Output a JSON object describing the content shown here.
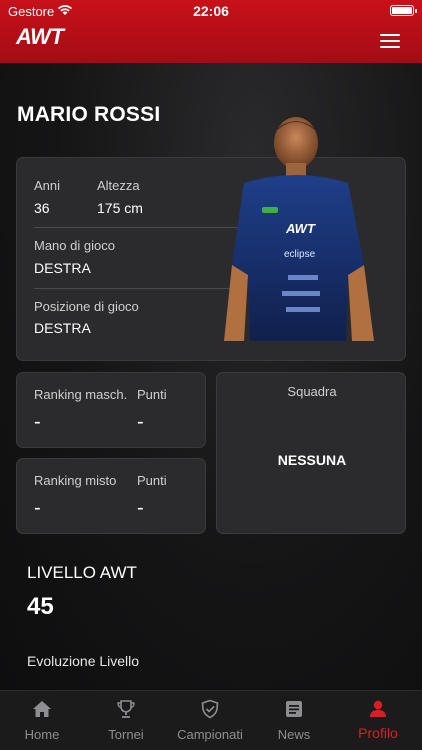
{
  "status_bar": {
    "carrier": "Gestore",
    "time": "22:06"
  },
  "header": {
    "logo": "AWT",
    "menu_icon": "hamburger-menu-icon"
  },
  "player": {
    "name": "MARIO ROSSI",
    "age_label": "Anni",
    "age_value": "36",
    "height_label": "Altezza",
    "height_value": "175 cm",
    "hand_label": "Mano di gioco",
    "hand_value": "DESTRA",
    "position_label": "Posizione di gioco",
    "position_value": "DESTRA"
  },
  "ranking_male": {
    "label": "Ranking masch.",
    "points_label": "Punti",
    "value": "-",
    "points": "-"
  },
  "ranking_mixed": {
    "label": "Ranking misto",
    "points_label": "Punti",
    "value": "-",
    "points": "-"
  },
  "team": {
    "label": "Squadra",
    "value": "NESSUNA"
  },
  "level": {
    "title": "LIVELLO AWT",
    "value": "45",
    "evolution_title": "Evoluzione Livello"
  },
  "tabs": [
    {
      "label": "Home",
      "icon": "home-icon"
    },
    {
      "label": "Tornei",
      "icon": "trophy-icon"
    },
    {
      "label": "Campionati",
      "icon": "shield-icon"
    },
    {
      "label": "News",
      "icon": "news-icon"
    },
    {
      "label": "Profilo",
      "icon": "profile-icon"
    }
  ],
  "colors": {
    "accent": "#d81f26",
    "header": "#b50e16",
    "card": "#2b2b2d"
  }
}
